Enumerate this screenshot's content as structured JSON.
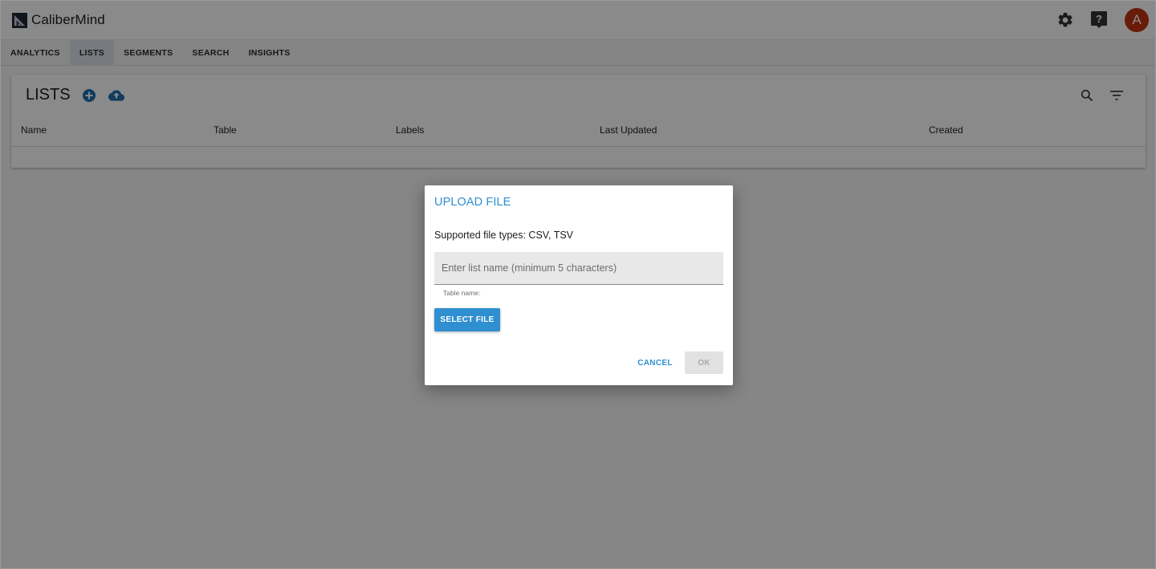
{
  "app": {
    "name": "CaliberMind",
    "user_initial": "A",
    "accent_color": "#2f8fd0",
    "avatar_color": "#c0320f",
    "brand_blue": "#1e6fb0"
  },
  "header": {
    "icons": [
      "gear-icon",
      "help-icon"
    ]
  },
  "nav": {
    "tabs": [
      {
        "label": "ANALYTICS",
        "active": false
      },
      {
        "label": "LISTS",
        "active": true
      },
      {
        "label": "SEGMENTS",
        "active": false
      },
      {
        "label": "SEARCH",
        "active": false
      },
      {
        "label": "INSIGHTS",
        "active": false
      }
    ]
  },
  "lists_card": {
    "title": "LISTS",
    "actions": [
      "add-icon",
      "cloud-upload-icon"
    ],
    "tools": [
      "search-icon",
      "filter-icon"
    ],
    "columns": [
      "Name",
      "Table",
      "Labels",
      "Last Updated",
      "Created"
    ],
    "rows": []
  },
  "dialog": {
    "title": "UPLOAD FILE",
    "description": "Supported file types: CSV, TSV",
    "list_name_value": "",
    "list_name_placeholder": "Enter list name (minimum 5 characters)",
    "helper_text": "Table name:",
    "select_file_label": "SELECT FILE",
    "cancel_label": "CANCEL",
    "ok_label": "OK",
    "ok_disabled": true
  }
}
